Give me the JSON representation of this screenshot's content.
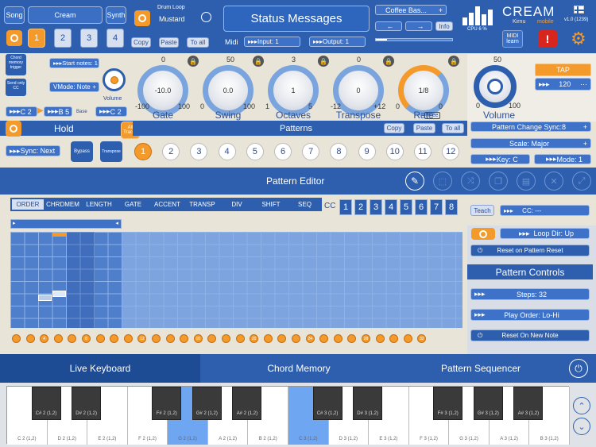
{
  "top": {
    "song": "Song",
    "preset": "Cream",
    "synth": "Synth",
    "slots": [
      "1",
      "2",
      "3",
      "4"
    ],
    "drum_loop_label": "Drum Loop",
    "drum_loop_value": "Mustard",
    "copy": "Copy",
    "paste": "Paste",
    "to_all": "To all",
    "midi": "Midi",
    "input": "Input: 1",
    "output": "Output: 1",
    "status": "Status Messages",
    "patch": "Coffee Bas...",
    "info": "Info",
    "cpu": "CPU 6 %",
    "brand": "CREAM",
    "brand_sub": "mobile",
    "brand_by": "Kirnu",
    "version": "v1.0 (1239)",
    "midi_learn_1": "MIDI",
    "midi_learn_2": "learn"
  },
  "left": {
    "chord_memory_trigger": "Chord memory trigger",
    "start_notes": "Start notes: 1",
    "send_only_cc": "Send only CC",
    "vmode": "VMode: Note",
    "volume": "Volume",
    "note_low": "C 2",
    "note_high": "B 5",
    "base": "Base",
    "base_note": "C 2",
    "hold": "Hold",
    "all_tracks": "All Tracks",
    "sync": "Sync: Next",
    "bypass": "Bypass",
    "transpose": "Transpose"
  },
  "knobs": [
    {
      "label": "Gate",
      "value": "-10.0",
      "top": "0",
      "min": "-100",
      "max": "100"
    },
    {
      "label": "Swing",
      "value": "0.0",
      "top": "50",
      "min": "0",
      "max": "100"
    },
    {
      "label": "Octaves",
      "value": "1",
      "top": "3",
      "min": "1",
      "max": "5"
    },
    {
      "label": "Transpose",
      "value": "0",
      "top": "0",
      "min": "-12",
      "max": "+12"
    },
    {
      "label": "Rate",
      "value": "1/8",
      "top": "",
      "min": "0",
      "max": "0",
      "extra": "Free"
    }
  ],
  "master": {
    "label": "Volume",
    "top": "50",
    "min": "0",
    "max": "100",
    "tap": "TAP",
    "bpm": "120"
  },
  "patterns": {
    "title": "Patterns",
    "copy": "Copy",
    "paste": "Paste",
    "to_all": "To all",
    "numbers": [
      "1",
      "2",
      "3",
      "4",
      "5",
      "6",
      "7",
      "8",
      "9",
      "10",
      "11",
      "12"
    ]
  },
  "right_top": {
    "change_sync": "Pattern Change Sync:8",
    "scale": "Scale: Major",
    "key": "Key: C",
    "mode": "Mode: 1"
  },
  "editor": {
    "title": "Pattern Editor",
    "tabs": [
      "ORDER",
      "CHRDMEM",
      "LENGTH",
      "GATE",
      "ACCENT",
      "TRANSP",
      "DIV",
      "SHIFT",
      "SEQ"
    ],
    "cc": "CC",
    "cc_numbers": [
      "1",
      "2",
      "3",
      "4",
      "5",
      "6",
      "7",
      "8"
    ],
    "step_dots": [
      "",
      "",
      "4",
      "",
      "",
      "8",
      "",
      "",
      "",
      "12",
      "",
      "",
      "",
      "16",
      "",
      "",
      "",
      "20",
      "",
      "",
      "",
      "24",
      "",
      "",
      "",
      "28",
      "",
      "",
      "",
      "32"
    ],
    "teach": "Teach",
    "cc_value": "CC: ---",
    "loop_dir": "Loop Dir: Up",
    "reset_on_pattern": "Reset on Pattern Reset",
    "controls_title": "Pattern Controls",
    "steps": "Steps: 32",
    "play_order": "Play Order: Lo-Hi",
    "reset_on_note": "Reset On New Note"
  },
  "bottom_tabs": [
    "Live Keyboard",
    "Chord Memory",
    "Pattern Sequencer"
  ],
  "keyboard": {
    "white": [
      "C 2 (1,2)",
      "D 2 (1,2)",
      "E 2 (1,2)",
      "F 2 (1,2)",
      "G 2 (1,2)",
      "A 2 (1,2)",
      "B 2 (1,2)",
      "C 3 (1,2)",
      "D 3 (1,2)",
      "E 3 (1,2)",
      "F 3 (1,2)",
      "G 3 (1,2)",
      "A 3 (1,2)",
      "B 3 (1,2)"
    ],
    "black": [
      "C# 2 (1,2)",
      "D# 2 (1,2)",
      "F# 2 (1,2)",
      "G# 2 (1,2)",
      "A# 2 (1,2)",
      "C# 3 (1,2)",
      "D# 3 (1,2)",
      "F# 3 (1,2)",
      "G# 3 (1,2)",
      "A# 3 (1,2)"
    ]
  }
}
